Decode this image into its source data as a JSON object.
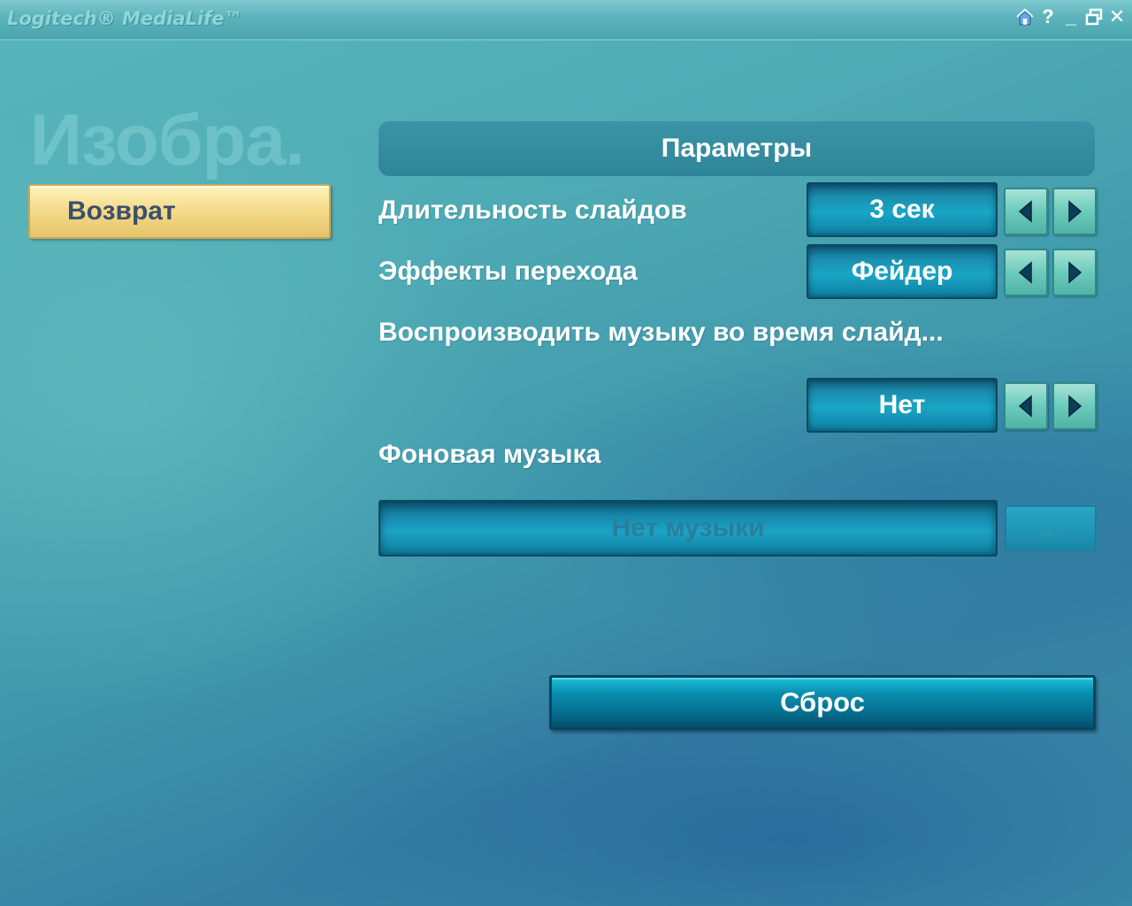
{
  "window": {
    "app_title": "Logitech® MediaLife™",
    "controls": [
      "home-icon",
      "help-icon",
      "minimize-icon",
      "restore-icon",
      "close-icon"
    ],
    "help_glyph": "?",
    "minimize_glyph": "_",
    "close_glyph": "✕"
  },
  "section_title": "Изобра.",
  "back_button": "Возврат",
  "params_header": "Параметры",
  "settings": [
    {
      "label": "Длительность слайдов",
      "value": "3 сек"
    },
    {
      "label": "Эффекты перехода",
      "value": "Фейдер"
    },
    {
      "label": "Воспроизводить музыку во время слайд...",
      "value": "Нет"
    }
  ],
  "background_music": {
    "label": "Фоновая музыка",
    "value": "Нет музыки",
    "browse_label": "..."
  },
  "reset_button": "Сброс",
  "colors": {
    "accent_gold": "#f5dc8c",
    "value_box": "#19a6c6",
    "arrow_button": "#6ccbbb",
    "background": "#4eaab4"
  }
}
